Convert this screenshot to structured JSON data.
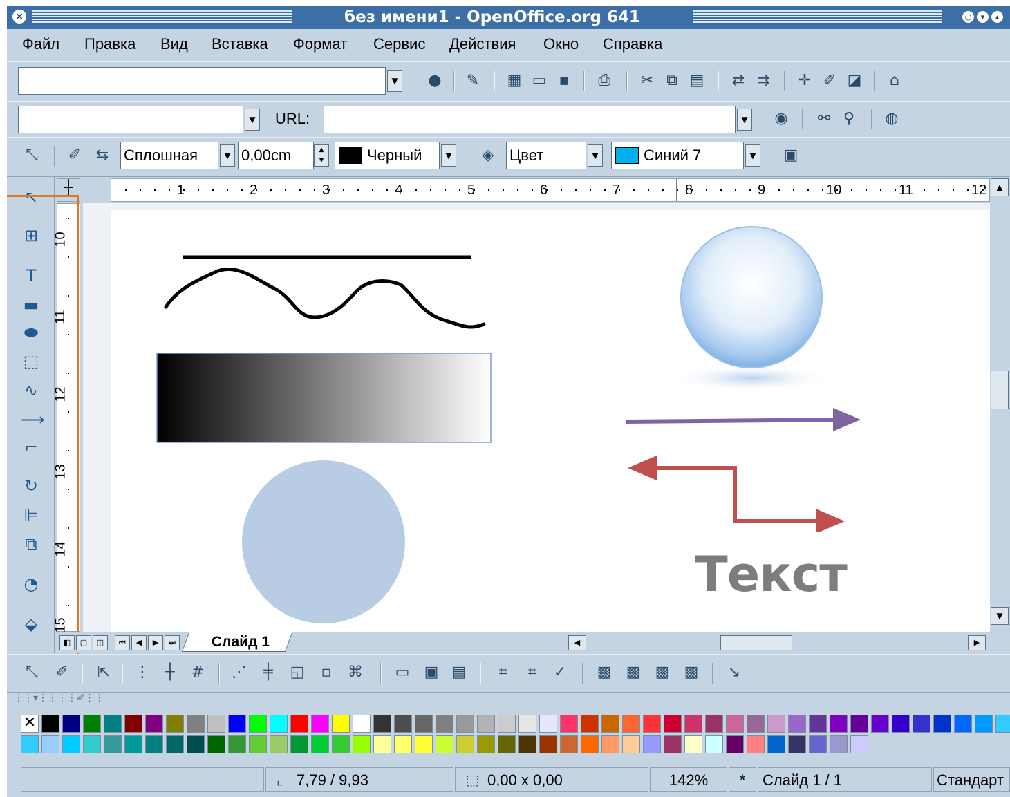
{
  "window": {
    "title": "без имени1 - OpenOffice.org 641"
  },
  "menu": [
    "Файл",
    "Правка",
    "Вид",
    "Вставка",
    "Формат",
    "Сервис",
    "Действия",
    "Окно",
    "Справка"
  ],
  "function_bar": {
    "url_label": "URL:"
  },
  "object_bar": {
    "line_style": "Сплошная",
    "line_width": "0,00cm",
    "line_color": "Черный",
    "area_style": "Цвет",
    "area_color": "Синий 7"
  },
  "ruler": {
    "horizontal": [
      "1",
      "2",
      "3",
      "4",
      "5",
      "6",
      "7",
      "8",
      "9",
      "10",
      "11",
      "12"
    ],
    "vertical": [
      "10",
      "11",
      "12",
      "13",
      "14",
      "15"
    ]
  },
  "slide": {
    "text_object": "Текст"
  },
  "tabs": {
    "active": "Слайд 1"
  },
  "status": {
    "position": "7,79 / 9,93",
    "size": "0,00 x 0,00",
    "zoom": "142%",
    "modified": "*",
    "slide": "Слайд 1 / 1",
    "layout": "Стандарт"
  },
  "colors": {
    "title_bar": "#3c6fa6",
    "chrome": "#c4d4e2",
    "highlight_frame": "#e07a22",
    "circle_fill": "#b8cce4",
    "purple_arrow": "#8064a2",
    "red_arrow": "#c0504d",
    "selected_area_color": "#00b0f0"
  },
  "palette": {
    "row1": [
      "#000000",
      "#000080",
      "#008000",
      "#008080",
      "#800000",
      "#800080",
      "#808000",
      "#808080",
      "#c0c0c0",
      "#0000ff",
      "#00ff00",
      "#00ffff",
      "#ff0000",
      "#ff00ff",
      "#ffff00",
      "#ffffff",
      "#333333",
      "#4d4d4d",
      "#666666",
      "#808080",
      "#999999",
      "#b3b3b3",
      "#cccccc",
      "#e6e6e6",
      "#e6e6ff",
      "#ff3366",
      "#cc3300",
      "#cc6600",
      "#ff6633",
      "#ff3333",
      "#cc0033",
      "#cc3366",
      "#993366",
      "#cc6699",
      "#996699",
      "#cc99cc",
      "#9966cc",
      "#663399",
      "#7f00bf",
      "#660099",
      "#6600cc",
      "#3300cc",
      "#3333cc",
      "#0033cc",
      "#0066ff",
      "#0099ff",
      "#33ccff"
    ],
    "row2": [
      "#33ccff",
      "#99ccff",
      "#00ccff",
      "#33cccc",
      "#339999",
      "#009999",
      "#008080",
      "#006666",
      "#004d4d",
      "#006600",
      "#339933",
      "#66cc33",
      "#99cc66",
      "#009933",
      "#00cc33",
      "#33cc33",
      "#99ff00",
      "#ffff99",
      "#ffff66",
      "#ffff33",
      "#ccff33",
      "#cccc33",
      "#999900",
      "#666600",
      "#4d3300",
      "#993300",
      "#cc6633",
      "#ff6600",
      "#ff9966",
      "#ffcc99",
      "#9999ff",
      "#993366",
      "#ffffcc",
      "#ccffff",
      "#660066",
      "#ff8080",
      "#0066cc",
      "#333366",
      "#6666cc",
      "#9999cc",
      "#ccccff"
    ]
  }
}
